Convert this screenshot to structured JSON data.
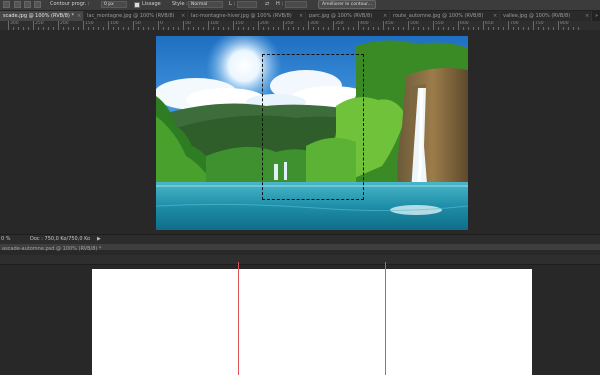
{
  "options_bar": {
    "contour_label": "Contour progr. :",
    "contour_value": "0 px",
    "lissage_label": "Lissage",
    "style_label": "Style :",
    "style_value": "Normal",
    "l_label": "L :",
    "h_label": "H :",
    "ameliorer_button": "Améliorer le contour..."
  },
  "tabs": [
    {
      "label": "scade.jpg @ 100% (RVB/8) *",
      "active": true
    },
    {
      "label": "lac_montagne.jpg @ 100% (RVB/8)",
      "active": false
    },
    {
      "label": "lac-montagne-hiver.jpg @ 100% (RVB/8)",
      "active": false
    },
    {
      "label": "parc.jpg @ 100% (RVB/8)",
      "active": false
    },
    {
      "label": "route_automne.jpg @ 100% (RVB/8)",
      "active": false
    },
    {
      "label": "vallee.jpg @ 100% (RVB/8)",
      "active": false
    }
  ],
  "ruler_labels": [
    "300",
    "250",
    "200",
    "150",
    "100",
    "50",
    "0",
    "50",
    "100",
    "150",
    "200",
    "250",
    "300",
    "350",
    "400",
    "450",
    "500",
    "550",
    "600",
    "650",
    "700",
    "750",
    "800"
  ],
  "status": {
    "zoom": "0 %",
    "doc": "Doc : 750,0 Ko/750,0 Ko"
  },
  "second_doc": {
    "tab_label": "ascade-automne.psd @ 100% (RVB/8) *"
  },
  "colors": {
    "workspace": "#282828",
    "guide": "#e0565b"
  }
}
